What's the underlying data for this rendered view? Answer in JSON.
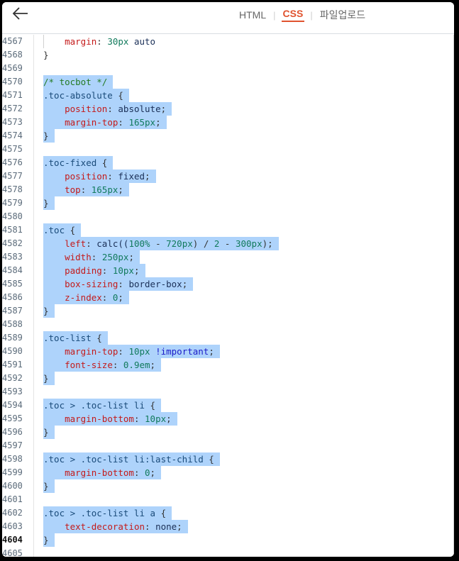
{
  "toolbar": {
    "back_icon": "arrow-left-icon",
    "tabs": [
      {
        "label": "HTML",
        "active": false
      },
      {
        "label": "CSS",
        "active": true
      },
      {
        "label": "파일업로드",
        "active": false
      }
    ]
  },
  "editor": {
    "current_line": "4604",
    "lines": [
      {
        "n": "4567",
        "sel": false,
        "tokens": [
          [
            "    ",
            ""
          ],
          [
            "margin",
            "prop"
          ],
          [
            ": ",
            "punc"
          ],
          [
            "30px",
            "num"
          ],
          [
            " auto",
            "val"
          ]
        ]
      },
      {
        "n": "4568",
        "sel": false,
        "tokens": [
          [
            "}",
            "punc"
          ]
        ]
      },
      {
        "n": "4569",
        "sel": false,
        "tokens": []
      },
      {
        "n": "4570",
        "sel": true,
        "tokens": [
          [
            "/* tocbot */",
            "cmt"
          ]
        ]
      },
      {
        "n": "4571",
        "sel": true,
        "tokens": [
          [
            ".toc-absolute",
            "sel"
          ],
          [
            " {",
            "punc"
          ]
        ]
      },
      {
        "n": "4572",
        "sel": true,
        "tokens": [
          [
            "    ",
            ""
          ],
          [
            "position",
            "prop"
          ],
          [
            ": ",
            "punc"
          ],
          [
            "absolute",
            "val"
          ],
          [
            ";",
            "punc"
          ]
        ]
      },
      {
        "n": "4573",
        "sel": true,
        "tokens": [
          [
            "    ",
            ""
          ],
          [
            "margin-top",
            "prop"
          ],
          [
            ": ",
            "punc"
          ],
          [
            "165px",
            "num"
          ],
          [
            ";",
            "punc"
          ]
        ]
      },
      {
        "n": "4574",
        "sel": true,
        "tokens": [
          [
            "}",
            "punc"
          ]
        ]
      },
      {
        "n": "4575",
        "sel": false,
        "tokens": []
      },
      {
        "n": "4576",
        "sel": true,
        "tokens": [
          [
            ".toc-fixed",
            "sel"
          ],
          [
            " {",
            "punc"
          ]
        ]
      },
      {
        "n": "4577",
        "sel": true,
        "tokens": [
          [
            "    ",
            ""
          ],
          [
            "position",
            "prop"
          ],
          [
            ": ",
            "punc"
          ],
          [
            "fixed",
            "val"
          ],
          [
            ";",
            "punc"
          ]
        ]
      },
      {
        "n": "4578",
        "sel": true,
        "tokens": [
          [
            "    ",
            ""
          ],
          [
            "top",
            "prop"
          ],
          [
            ": ",
            "punc"
          ],
          [
            "165px",
            "num"
          ],
          [
            ";",
            "punc"
          ]
        ]
      },
      {
        "n": "4579",
        "sel": true,
        "tokens": [
          [
            "}",
            "punc"
          ]
        ]
      },
      {
        "n": "4580",
        "sel": false,
        "tokens": []
      },
      {
        "n": "4581",
        "sel": true,
        "tokens": [
          [
            ".toc",
            "sel"
          ],
          [
            " {",
            "punc"
          ]
        ]
      },
      {
        "n": "4582",
        "sel": true,
        "tokens": [
          [
            "    ",
            ""
          ],
          [
            "left",
            "prop"
          ],
          [
            ": ",
            "punc"
          ],
          [
            "calc((",
            "val"
          ],
          [
            "100%",
            "num"
          ],
          [
            " - ",
            "punc"
          ],
          [
            "720px",
            "num"
          ],
          [
            ") / ",
            "punc"
          ],
          [
            "2",
            "num"
          ],
          [
            " - ",
            "punc"
          ],
          [
            "300px",
            "num"
          ],
          [
            ");",
            "punc"
          ]
        ]
      },
      {
        "n": "4583",
        "sel": true,
        "tokens": [
          [
            "    ",
            ""
          ],
          [
            "width",
            "prop"
          ],
          [
            ": ",
            "punc"
          ],
          [
            "250px",
            "num"
          ],
          [
            ";",
            "punc"
          ]
        ]
      },
      {
        "n": "4584",
        "sel": true,
        "tokens": [
          [
            "    ",
            ""
          ],
          [
            "padding",
            "prop"
          ],
          [
            ": ",
            "punc"
          ],
          [
            "10px",
            "num"
          ],
          [
            ";",
            "punc"
          ]
        ]
      },
      {
        "n": "4585",
        "sel": true,
        "tokens": [
          [
            "    ",
            ""
          ],
          [
            "box-sizing",
            "prop"
          ],
          [
            ": ",
            "punc"
          ],
          [
            "border-box",
            "val"
          ],
          [
            ";",
            "punc"
          ]
        ]
      },
      {
        "n": "4586",
        "sel": true,
        "tokens": [
          [
            "    ",
            ""
          ],
          [
            "z-index",
            "prop"
          ],
          [
            ": ",
            "punc"
          ],
          [
            "0",
            "num"
          ],
          [
            ";",
            "punc"
          ]
        ]
      },
      {
        "n": "4587",
        "sel": true,
        "tokens": [
          [
            "}",
            "punc"
          ]
        ]
      },
      {
        "n": "4588",
        "sel": false,
        "tokens": []
      },
      {
        "n": "4589",
        "sel": true,
        "tokens": [
          [
            ".toc-list",
            "sel"
          ],
          [
            " {",
            "punc"
          ]
        ]
      },
      {
        "n": "4590",
        "sel": true,
        "tokens": [
          [
            "    ",
            ""
          ],
          [
            "margin-top",
            "prop"
          ],
          [
            ": ",
            "punc"
          ],
          [
            "10px",
            "num"
          ],
          [
            " ",
            ""
          ],
          [
            "!important",
            "kw"
          ],
          [
            ";",
            "punc"
          ]
        ]
      },
      {
        "n": "4591",
        "sel": true,
        "tokens": [
          [
            "    ",
            ""
          ],
          [
            "font-size",
            "prop"
          ],
          [
            ": ",
            "punc"
          ],
          [
            "0.9em",
            "num"
          ],
          [
            ";",
            "punc"
          ]
        ]
      },
      {
        "n": "4592",
        "sel": true,
        "tokens": [
          [
            "}",
            "punc"
          ]
        ]
      },
      {
        "n": "4593",
        "sel": false,
        "tokens": []
      },
      {
        "n": "4594",
        "sel": true,
        "tokens": [
          [
            ".toc > .toc-list li",
            "sel"
          ],
          [
            " {",
            "punc"
          ]
        ]
      },
      {
        "n": "4595",
        "sel": true,
        "tokens": [
          [
            "    ",
            ""
          ],
          [
            "margin-bottom",
            "prop"
          ],
          [
            ": ",
            "punc"
          ],
          [
            "10px",
            "num"
          ],
          [
            ";",
            "punc"
          ]
        ]
      },
      {
        "n": "4596",
        "sel": true,
        "tokens": [
          [
            "}",
            "punc"
          ]
        ]
      },
      {
        "n": "4597",
        "sel": false,
        "tokens": []
      },
      {
        "n": "4598",
        "sel": true,
        "tokens": [
          [
            ".toc > .toc-list li:last-child",
            "sel"
          ],
          [
            " {",
            "punc"
          ]
        ]
      },
      {
        "n": "4599",
        "sel": true,
        "tokens": [
          [
            "    ",
            ""
          ],
          [
            "margin-bottom",
            "prop"
          ],
          [
            ": ",
            "punc"
          ],
          [
            "0",
            "num"
          ],
          [
            ";",
            "punc"
          ]
        ]
      },
      {
        "n": "4600",
        "sel": true,
        "tokens": [
          [
            "}",
            "punc"
          ]
        ]
      },
      {
        "n": "4601",
        "sel": false,
        "tokens": []
      },
      {
        "n": "4602",
        "sel": true,
        "tokens": [
          [
            ".toc > .toc-list li a",
            "sel"
          ],
          [
            " {",
            "punc"
          ]
        ]
      },
      {
        "n": "4603",
        "sel": true,
        "tokens": [
          [
            "    ",
            ""
          ],
          [
            "text-decoration",
            "prop"
          ],
          [
            ": ",
            "punc"
          ],
          [
            "none",
            "val"
          ],
          [
            ";",
            "punc"
          ]
        ]
      },
      {
        "n": "4604",
        "sel": true,
        "tokens": [
          [
            "}",
            "punc"
          ]
        ]
      },
      {
        "n": "4605",
        "sel": false,
        "tokens": []
      }
    ]
  }
}
